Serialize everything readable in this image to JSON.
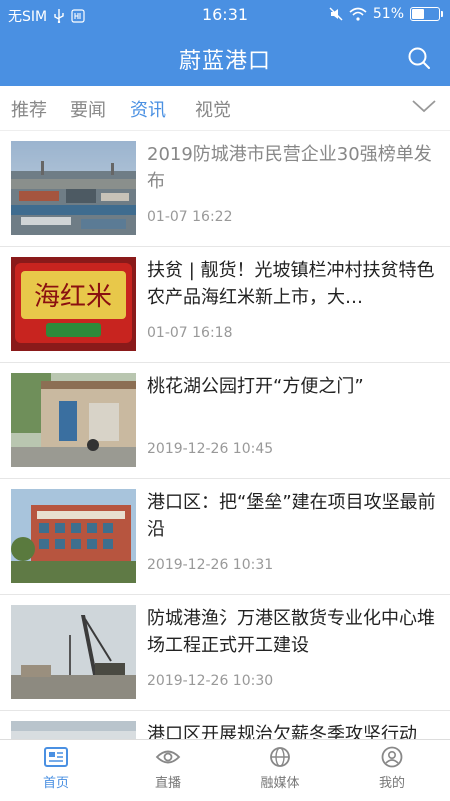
{
  "status_bar": {
    "carrier": "无SIM",
    "time": "16:31",
    "battery": "51%",
    "battery_level": 0.51
  },
  "header": {
    "title": "蔚蓝港口"
  },
  "tabs": [
    {
      "label": "推荐"
    },
    {
      "label": "要闻"
    },
    {
      "label": "资讯"
    },
    {
      "label": "视觉"
    }
  ],
  "articles": [
    {
      "title": "2019防城港市民营企业30强榜单发布",
      "time": "01-07 16:22"
    },
    {
      "title": "扶贫 | 靓货！光坡镇栏冲村扶贫特色农产品海红米新上市，大…",
      "time": "01-07 16:18",
      "thumb_text": "海红米"
    },
    {
      "title": "桃花湖公园打开“方便之门”",
      "time": "2019-12-26 10:45"
    },
    {
      "title": "港口区：把“堡垒”建在项目攻坚最前沿",
      "time": "2019-12-26 10:31"
    },
    {
      "title": "防城港渔氵万港区散货专业化中心堆场工程正式开工建设",
      "time": "2019-12-26 10:30"
    },
    {
      "title": "港口区开展规治欠薪冬季攻坚行动",
      "time": ""
    }
  ],
  "bottom_nav": [
    {
      "label": "首页"
    },
    {
      "label": "直播"
    },
    {
      "label": "融媒体"
    },
    {
      "label": "我的"
    }
  ],
  "colors": {
    "brand": "#4a90e2",
    "text": "#222222",
    "muted": "#999999"
  }
}
